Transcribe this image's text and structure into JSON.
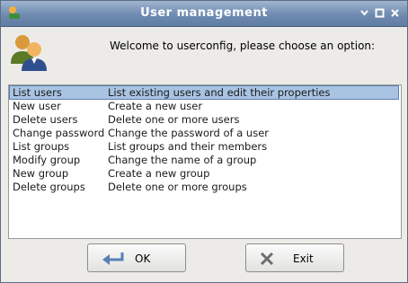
{
  "window": {
    "title": "User management"
  },
  "header": {
    "welcome": "Welcome to userconfig, please choose an option:"
  },
  "options": [
    {
      "name": "List users",
      "desc": "List existing users and edit their properties"
    },
    {
      "name": "New user",
      "desc": "Create a new user"
    },
    {
      "name": "Delete users",
      "desc": "Delete one or more users"
    },
    {
      "name": "Change password",
      "desc": "Change the password of a user"
    },
    {
      "name": "List groups",
      "desc": "List groups and their members"
    },
    {
      "name": "Modify group",
      "desc": "Change the name of a group"
    },
    {
      "name": "New group",
      "desc": "Create a new group"
    },
    {
      "name": "Delete groups",
      "desc": "Delete one or more groups"
    }
  ],
  "selected_index": 0,
  "buttons": {
    "ok": "OK",
    "exit": "Exit"
  },
  "icons": {
    "app": "app-icon",
    "users": "users-icon",
    "ok": "enter-arrow-icon",
    "exit": "x-icon",
    "minimize": "minimize-icon",
    "maximize": "maximize-icon",
    "close": "close-icon"
  },
  "colors": {
    "titlebar": "#6f8bb0",
    "selection": "#a9c4e3"
  }
}
